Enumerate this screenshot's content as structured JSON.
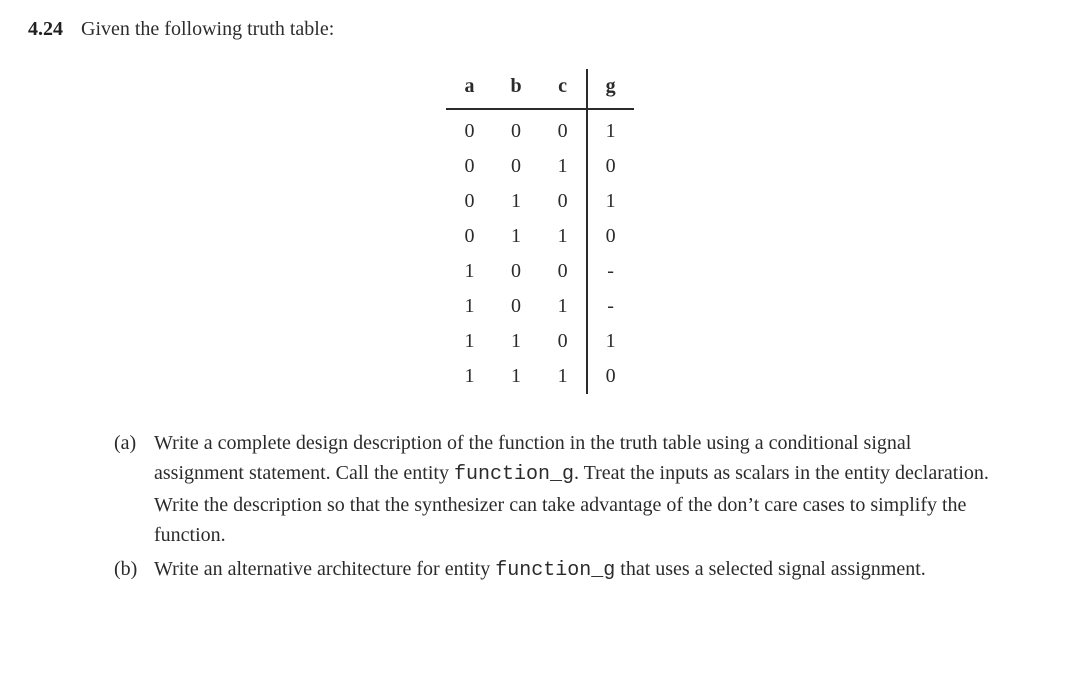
{
  "problem": {
    "number": "4.24",
    "intro": "Given the following truth table:"
  },
  "table": {
    "headers": [
      "a",
      "b",
      "c",
      "g"
    ],
    "rows": [
      [
        "0",
        "0",
        "0",
        "1"
      ],
      [
        "0",
        "0",
        "1",
        "0"
      ],
      [
        "0",
        "1",
        "0",
        "1"
      ],
      [
        "0",
        "1",
        "1",
        "0"
      ],
      [
        "1",
        "0",
        "0",
        "-"
      ],
      [
        "1",
        "0",
        "1",
        "-"
      ],
      [
        "1",
        "1",
        "0",
        "1"
      ],
      [
        "1",
        "1",
        "1",
        "0"
      ]
    ]
  },
  "parts": {
    "a": {
      "label": "(a)",
      "segments": [
        "Write a complete design description of the function in the truth table using a conditional signal assignment statement. Call the entity ",
        "function_g",
        ". Treat the inputs as scalars in the entity declaration. Write the description so that the synthesizer can take advantage of the don’t care cases to simplify the function."
      ]
    },
    "b": {
      "label": "(b)",
      "segments": [
        "Write an alternative architecture for entity ",
        "function_g",
        " that uses a selected signal assignment."
      ]
    }
  }
}
